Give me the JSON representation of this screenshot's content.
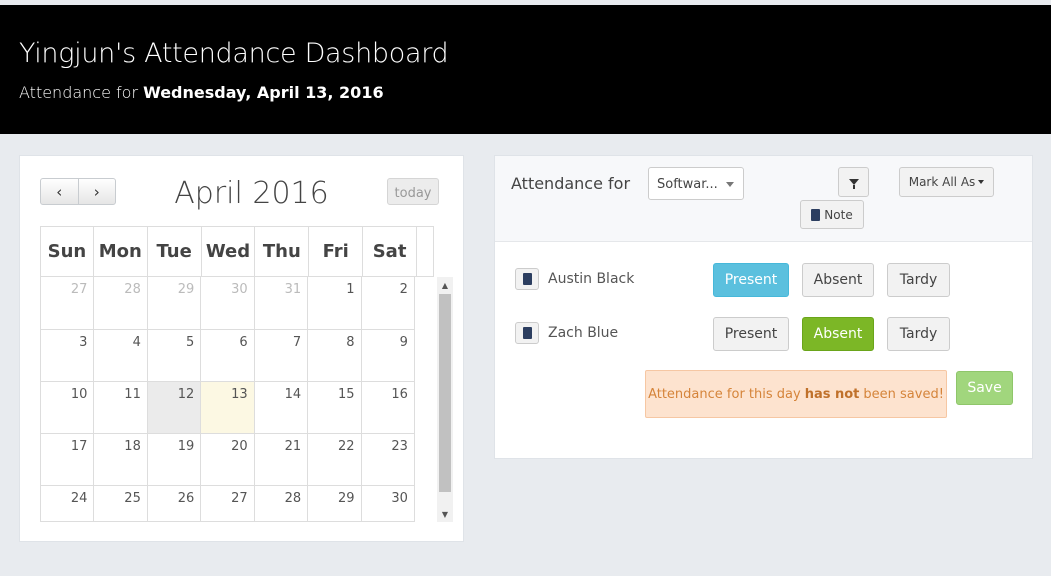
{
  "header": {
    "title": "Yingjun's Attendance Dashboard",
    "subtitle_prefix": "Attendance for",
    "subtitle_date": "Wednesday, April 13, 2016"
  },
  "calendar": {
    "prev_icon": "chevron-left-icon",
    "next_icon": "chevron-right-icon",
    "prev_label": "‹",
    "next_label": "›",
    "month_title": "April 2016",
    "today_label": "today",
    "weekdays": [
      "Sun",
      "Mon",
      "Tue",
      "Wed",
      "Thu",
      "Fri",
      "Sat"
    ],
    "weeks": [
      [
        "27",
        "28",
        "29",
        "30",
        "31",
        "1",
        "2"
      ],
      [
        "3",
        "4",
        "5",
        "6",
        "7",
        "8",
        "9"
      ],
      [
        "10",
        "11",
        "12",
        "13",
        "14",
        "15",
        "16"
      ],
      [
        "17",
        "18",
        "19",
        "20",
        "21",
        "22",
        "23"
      ],
      [
        "24",
        "25",
        "26",
        "27",
        "28",
        "29",
        "30"
      ]
    ],
    "selected_day": "12",
    "today_day": "13"
  },
  "attendance": {
    "label": "Attendance for",
    "class_select_value": "Softwar...",
    "filter_icon": "filter-icon",
    "mark_all_label": "Mark All As",
    "note_label": "Note",
    "students": [
      {
        "name": "Austin Black",
        "status": "Present"
      },
      {
        "name": "Zach Blue",
        "status": "Absent"
      }
    ],
    "status_options": [
      "Present",
      "Absent",
      "Tardy"
    ],
    "warning_prefix": "Attendance for this day",
    "warning_bold": "has not",
    "warning_suffix": "been saved!",
    "save_label": "Save"
  },
  "colors": {
    "header_bg": "#000000",
    "present_active": "#5bc0de",
    "absent_active": "#7cb726",
    "warning_bg": "#fde3cf",
    "save_bg": "#a1d67d"
  }
}
